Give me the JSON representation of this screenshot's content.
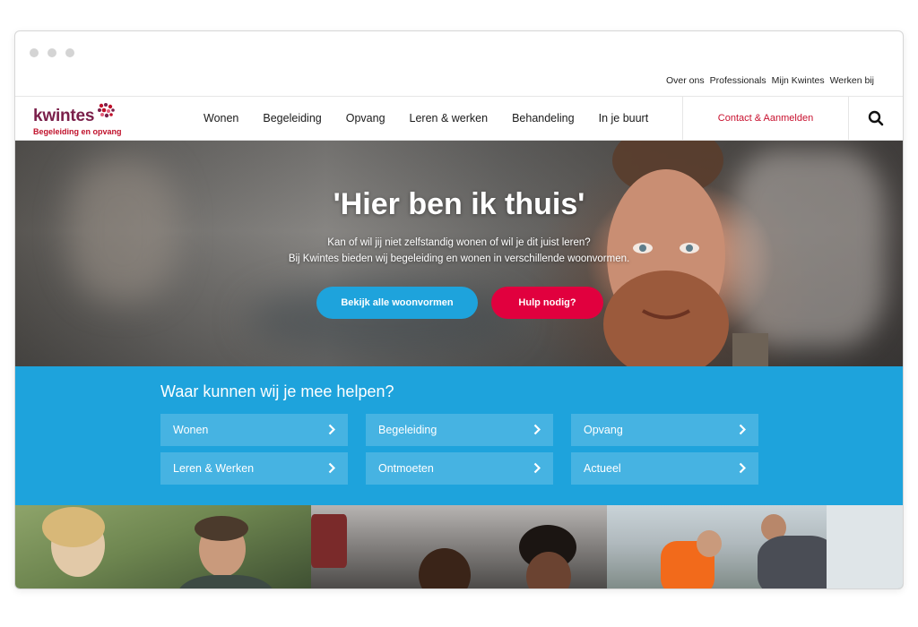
{
  "utility_nav": [
    "Over ons",
    "Professionals",
    "Mijn Kwintes",
    "Werken bij"
  ],
  "logo": {
    "wordmark": "kwintes",
    "tagline": "Begeleiding en opvang"
  },
  "main_nav": [
    "Wonen",
    "Begeleiding",
    "Opvang",
    "Leren & werken",
    "Behandeling",
    "In je buurt"
  ],
  "contact_link": "Contact & Aanmelden",
  "search_icon": "search-icon",
  "hero": {
    "title": "'Hier ben ik thuis'",
    "line1": "Kan of wil jij niet zelfstandig wonen of wil je dit juist leren?",
    "line2": "Bij Kwintes bieden wij begeleiding en wonen in verschillende woonvormen.",
    "button_primary": "Bekijk alle woonvormen",
    "button_secondary": "Hulp nodig?"
  },
  "help_section": {
    "title": "Waar kunnen wij je mee helpen?",
    "tiles": [
      "Wonen",
      "Begeleiding",
      "Opvang",
      "Leren & Werken",
      "Ontmoeten",
      "Actueel"
    ]
  },
  "colors": {
    "brand_blue": "#1ea3dc",
    "brand_red": "#e1003e",
    "logo_purple": "#7a1f4a",
    "contact_red": "#c8102e"
  }
}
